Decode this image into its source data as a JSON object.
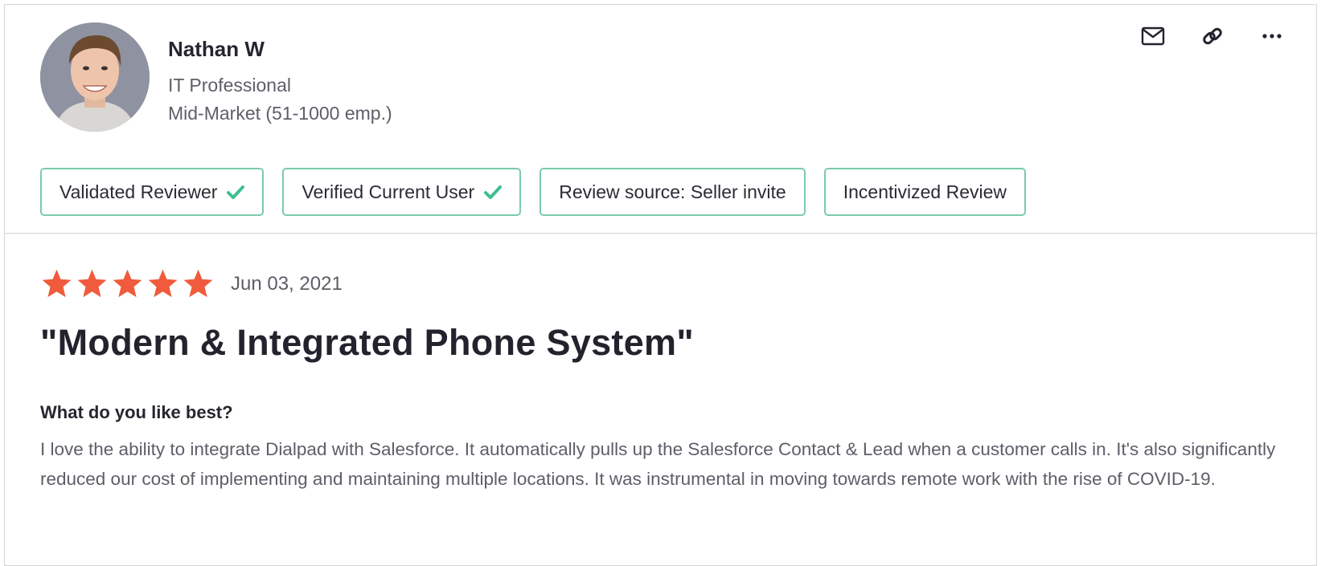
{
  "reviewer": {
    "name": "Nathan W",
    "role": "IT Professional",
    "segment": "Mid-Market (51-1000 emp.)"
  },
  "actions": {
    "email_icon": "envelope-icon",
    "link_icon": "link-icon",
    "more_icon": "more-icon"
  },
  "badges": [
    {
      "label": "Validated Reviewer",
      "check": true
    },
    {
      "label": "Verified Current User",
      "check": true
    },
    {
      "label": "Review source: Seller invite",
      "check": false
    },
    {
      "label": "Incentivized Review",
      "check": false
    }
  ],
  "review": {
    "rating": 5,
    "rating_max": 5,
    "date": "Jun 03, 2021",
    "title": "\"Modern & Integrated Phone System\"",
    "question": "What do you like best?",
    "answer": "I love the ability to integrate Dialpad with Salesforce. It automatically pulls up the Salesforce Contact & Lead when a customer calls in. It's also significantly reduced our cost of implementing and maintaining multiple locations. It was instrumental in moving towards remote work with the rise of COVID-19."
  },
  "colors": {
    "star": "#f05b3d",
    "badge_border": "#7bcba9",
    "check": "#3fbf8f"
  }
}
